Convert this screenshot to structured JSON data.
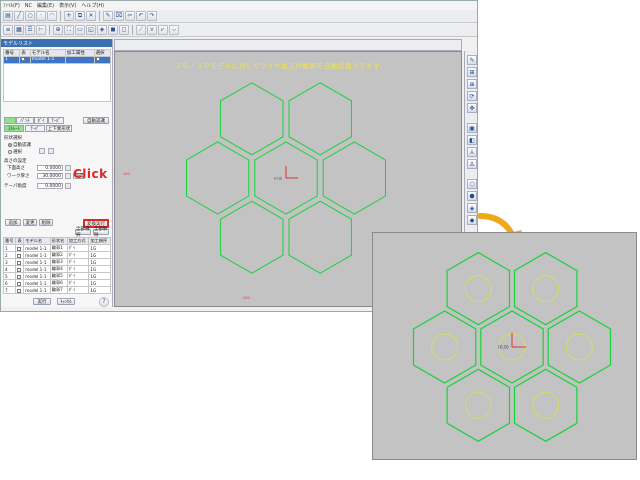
{
  "menubar": [
    "ﾌｧｲﾙ(F)",
    "NC",
    "編集(E)",
    "表示(V)",
    "ヘルプ(H)"
  ],
  "viewport": {
    "header_label": "",
    "caption": "２Ｄ／３Ｄモデルに対してワイヤ加工の輪郭を自動認識できます。",
    "origin_label": "(0,0)",
    "axis_x_label": "X",
    "axis_y_label": "Y",
    "left_mark": "100",
    "bottom_mark": "200",
    "colors": {
      "background": "#c3c3c3",
      "hexagon": "#18d23a",
      "hole": "#e0e63a",
      "axis_x": "#e22222",
      "axis_y": "#e22222",
      "caption": "#f2e63a"
    }
  },
  "model_panel": {
    "title": "モデルリスト",
    "columns": [
      "番号",
      "表",
      "モデル名",
      "加工属性",
      "選択"
    ],
    "rows": [
      {
        "no": "1",
        "name": "model 1-1",
        "attr": ""
      }
    ]
  },
  "settings": {
    "auto_button": "自動認識",
    "tabs": [
      "ﾊﾟﾝﾁ",
      "ﾀﾞｲ",
      "ﾃｰﾊﾟ"
    ],
    "subtabs": [
      "ｽﾄﾚｰﾄ",
      "ﾃｰﾊﾟ",
      "上下異形状"
    ],
    "section_title": "形状選択",
    "radio_all": "自動認識",
    "radio_select": "選択",
    "height_title": "高さの設定",
    "height_lower_label": "下面高さ",
    "height_lower_value": "0.0000",
    "height_work_label": "ワーク厚さ",
    "height_work_value": "30.0000",
    "height_work_btn": "取得",
    "taper_label": "テーパ角度",
    "taper_value": "0.0000"
  },
  "action_buttons": {
    "add": "追加",
    "edit": "変更",
    "delete": "削除",
    "confirm": "確認",
    "confirm2": "変換実行"
  },
  "click_label": "Click !",
  "part_buttons": {
    "all_on": "全部選択",
    "all_off": "全部解除"
  },
  "part_table": {
    "columns": [
      "番号",
      "表",
      "モデル名",
      "形状名",
      "加工方式",
      "加工順序"
    ],
    "rows": [
      [
        "1",
        "model 1-1",
        "輪郭1",
        "ﾀﾞｲ",
        "1G"
      ],
      [
        "2",
        "model 1-1",
        "輪郭2",
        "ﾀﾞｲ",
        "1G"
      ],
      [
        "3",
        "model 1-1",
        "輪郭3",
        "ﾀﾞｲ",
        "1G"
      ],
      [
        "4",
        "model 1-1",
        "輪郭4",
        "ﾀﾞｲ",
        "1G"
      ],
      [
        "5",
        "model 1-1",
        "輪郭5",
        "ﾀﾞｲ",
        "1G"
      ],
      [
        "6",
        "model 1-1",
        "輪郭6",
        "ﾀﾞｲ",
        "1G"
      ],
      [
        "7",
        "model 1-1",
        "輪郭7",
        "ﾀﾞｲ",
        "1G"
      ]
    ]
  },
  "footer_buttons": {
    "ok": "実行",
    "cancel": "ｷｬﾝｾﾙ"
  },
  "icons": [
    "file-icon",
    "open-icon",
    "save-icon",
    "undo-icon",
    "redo-icon",
    "zoom-icon",
    "rotate-icon",
    "pan-icon",
    "fit-icon",
    "view-icon",
    "help-icon"
  ]
}
